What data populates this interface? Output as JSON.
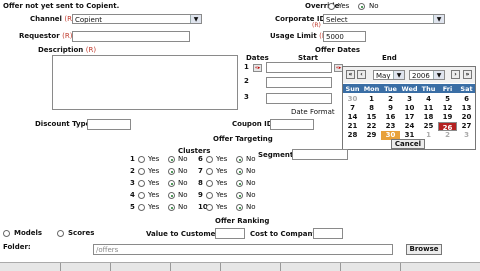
{
  "status_message": "Offer not yet sent to Copient.",
  "override": {
    "label": "Override",
    "yes": "Yes",
    "no": "No",
    "selected": "no"
  },
  "channel": {
    "label": "Channel",
    "req": "(R)",
    "value": "Copient"
  },
  "corporate_id": {
    "label": "Corporate ID",
    "req": "(R)",
    "value": "Select"
  },
  "requestor": {
    "label": "Requestor",
    "req": "(R)",
    "value": ""
  },
  "usage_limit": {
    "label": "Usage Limit",
    "req": "(R)",
    "value": "5000"
  },
  "description": {
    "label": "Description",
    "req": "(R)",
    "value": ""
  },
  "offer_dates": {
    "title": "Offer Dates",
    "dates_label": "Dates",
    "start": "Start",
    "end": "End",
    "rows": [
      "1",
      "2",
      "3"
    ],
    "date_format": "Date Format"
  },
  "calendar": {
    "prev_year": "«",
    "prev_month": "‹",
    "next_month": "›",
    "next_year": "»",
    "month": "May",
    "year": "2006",
    "dow": [
      "Sun",
      "Mon",
      "Tue",
      "Wed",
      "Thu",
      "Fri",
      "Sat"
    ],
    "weeks": [
      [
        "30",
        "1",
        "2",
        "3",
        "4",
        "5",
        "6"
      ],
      [
        "7",
        "8",
        "9",
        "10",
        "11",
        "12",
        "13"
      ],
      [
        "14",
        "15",
        "16",
        "17",
        "18",
        "19",
        "20"
      ],
      [
        "21",
        "22",
        "23",
        "24",
        "25",
        "26",
        "27"
      ],
      [
        "28",
        "29",
        "30",
        "31",
        "1",
        "2",
        "3"
      ]
    ],
    "cancel": "Cancel"
  },
  "discount_type": {
    "label": "Discount Type",
    "value": ""
  },
  "coupon_id": {
    "label": "Coupon ID",
    "value": ""
  },
  "offer_targeting": {
    "title": "Offer Targeting",
    "clusters": "Clusters",
    "segment": "Segment",
    "segment_value": "",
    "yes": "Yes",
    "no": "No"
  },
  "cluster_rows": [
    {
      "left_num": "1",
      "right_num": "6"
    },
    {
      "left_num": "2",
      "right_num": "7"
    },
    {
      "left_num": "3",
      "right_num": "8"
    },
    {
      "left_num": "4",
      "right_num": "9"
    },
    {
      "left_num": "5",
      "right_num": "10"
    }
  ],
  "offer_ranking": {
    "title": "Offer Ranking",
    "models": "Models",
    "scores": "Scores",
    "value_to_customer": "Value to Customer",
    "cost_to_company": "Cost to Company"
  },
  "folder": {
    "label": "Folder:",
    "value": "/offers",
    "browse": "Browse"
  },
  "colors": {
    "required": "#c0392b",
    "calendar_header": "#3a6ea5",
    "selected_day": "#b42020",
    "today": "#e8a13a",
    "radio_dot": "#1c7a2a"
  }
}
